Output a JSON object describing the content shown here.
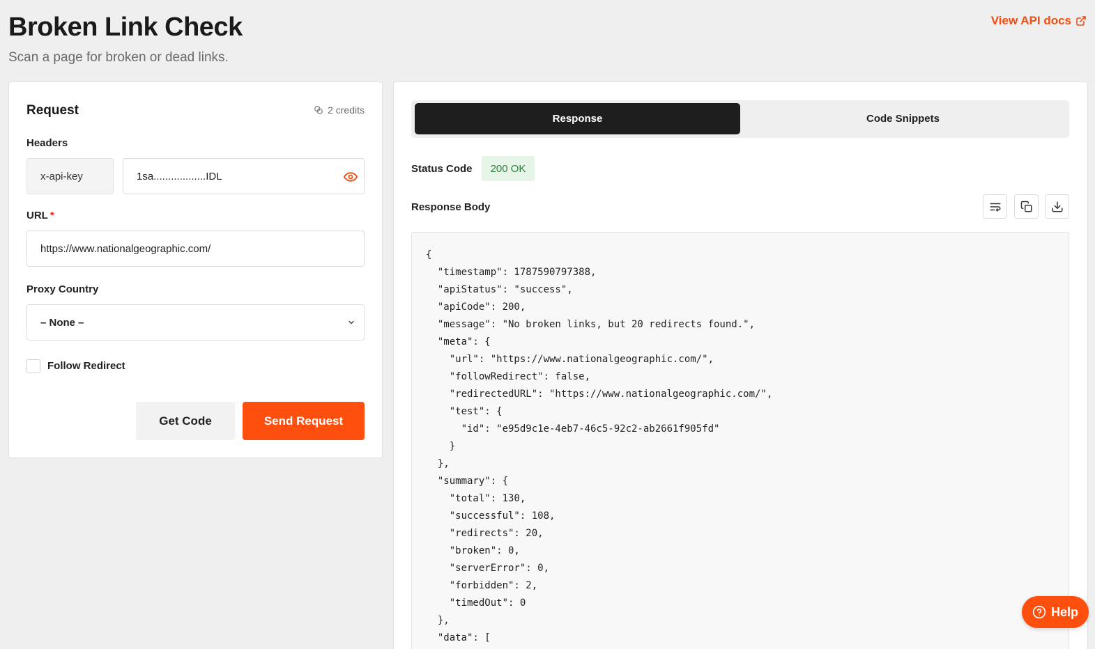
{
  "header": {
    "title": "Broken Link Check",
    "subtitle": "Scan a page for broken or dead links.",
    "api_docs_label": "View API docs"
  },
  "request": {
    "title": "Request",
    "credits": "2 credits",
    "headers_label": "Headers",
    "header_key": "x-api-key",
    "header_value": "1sa..................IDL",
    "url_label": "URL",
    "url_required_mark": "*",
    "url_value": "https://www.nationalgeographic.com/",
    "proxy_label": "Proxy Country",
    "proxy_value": "– None –",
    "follow_redirect_label": "Follow Redirect",
    "follow_redirect_checked": false,
    "get_code_label": "Get Code",
    "send_label": "Send Request"
  },
  "response": {
    "tabs": [
      {
        "label": "Response",
        "active": true
      },
      {
        "label": "Code Snippets",
        "active": false
      }
    ],
    "status_label": "Status Code",
    "status_value": "200 OK",
    "body_label": "Response Body",
    "body_text": "{\n  \"timestamp\": 1787590797388,\n  \"apiStatus\": \"success\",\n  \"apiCode\": 200,\n  \"message\": \"No broken links, but 20 redirects found.\",\n  \"meta\": {\n    \"url\": \"https://www.nationalgeographic.com/\",\n    \"followRedirect\": false,\n    \"redirectedURL\": \"https://www.nationalgeographic.com/\",\n    \"test\": {\n      \"id\": \"e95d9c1e-4eb7-46c5-92c2-ab2661f905fd\"\n    }\n  },\n  \"summary\": {\n    \"total\": 130,\n    \"successful\": 108,\n    \"redirects\": 20,\n    \"broken\": 0,\n    \"serverError\": 0,\n    \"forbidden\": 2,\n    \"timedOut\": 0\n  },\n  \"data\": ["
  },
  "help": {
    "label": "Help"
  },
  "colors": {
    "accent": "#ff4f0f",
    "link": "#f04d12",
    "status_bg": "#e6f5e8",
    "status_text": "#2f7d3c",
    "tab_active_bg": "#1e1e1e"
  },
  "icons": [
    "external-link-icon",
    "coins-icon",
    "eye-icon",
    "chevron-down-icon",
    "wrap-text-icon",
    "copy-icon",
    "download-icon",
    "help-circle-icon"
  ]
}
